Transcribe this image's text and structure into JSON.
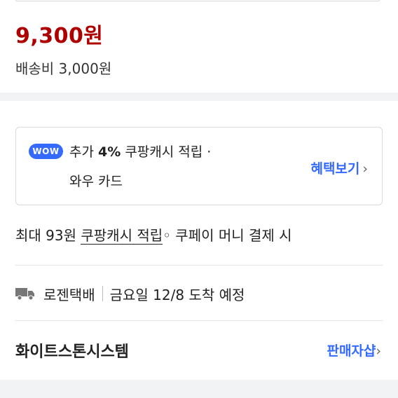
{
  "product": {
    "price": "9,300원",
    "shipping_fee": "배송비 3,000원"
  },
  "wow_benefit": {
    "badge": "WOW",
    "line1_prefix": "추가",
    "line1_percent": "4%",
    "line1_suffix": "쿠팡캐시 적립 ·",
    "line2": "와우 카드",
    "link_label": "혜택보기",
    "chevron": "›"
  },
  "cash_reward": {
    "prefix": "최대 93원",
    "highlight": "쿠팡캐시 적립",
    "suffix": "◦ 쿠페이 머니 결제 시"
  },
  "delivery": {
    "icon": "truck-icon",
    "method": "로젠택배",
    "eta": "금요일 12/8 도착 예정"
  },
  "seller": {
    "name": "화이트스톤시스템",
    "link_label": "판매자샵",
    "chevron": "›"
  },
  "colors": {
    "price_red": "#ae0000",
    "accent_blue": "#346aff",
    "section_gap": "#f2f3f5"
  }
}
